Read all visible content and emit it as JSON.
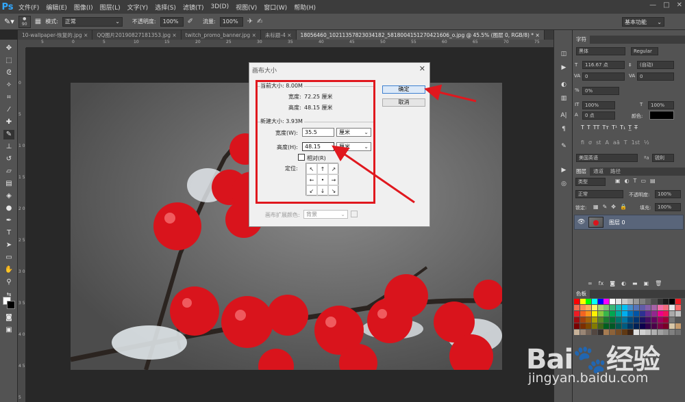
{
  "app": {
    "logo": "Ps",
    "menu": [
      "文件(F)",
      "编辑(E)",
      "图像(I)",
      "图层(L)",
      "文字(Y)",
      "选择(S)",
      "滤镜(T)",
      "3D(D)",
      "视图(V)",
      "窗口(W)",
      "帮助(H)"
    ],
    "window_controls": [
      "—",
      "□",
      "✕"
    ]
  },
  "options": {
    "brush_size": "90",
    "mode_label": "模式:",
    "mode_value": "正常",
    "opacity_label": "不透明度:",
    "opacity_value": "100%",
    "flow_label": "流量:",
    "flow_value": "100%",
    "workspace": "基本功能"
  },
  "tabs": [
    {
      "label": "10-wallpaper-恢复的.jpg",
      "active": false
    },
    {
      "label": "QQ图片20190827181353.jpg",
      "active": false
    },
    {
      "label": "twitch_promo_banner.jpg",
      "active": false
    },
    {
      "label": "未标题-4",
      "active": false
    },
    {
      "label": "18056460_10211357823034182_5818004151270421606_o.jpg @ 45.5% (图层 0, RGB/8) *",
      "active": true
    }
  ],
  "ruler_top": [
    "5",
    "0",
    "5",
    "10",
    "15",
    "20",
    "25",
    "30",
    "35",
    "40",
    "45",
    "50",
    "55",
    "60",
    "65",
    "70",
    "75"
  ],
  "ruler_left": [
    "0",
    "5",
    "1 0",
    "1 5",
    "2 0",
    "2 5",
    "3 0",
    "3 5",
    "4 0",
    "4 5",
    "5"
  ],
  "panels": {
    "char_tab": "字符",
    "font_family": "黑体",
    "font_style": "Regular",
    "font_size": "116.67 点",
    "leading": "(自动)",
    "kerning": "0",
    "tracking": "0",
    "scale": "0%",
    "vscale": "100%",
    "hscale": "100%",
    "baseline": "0 点",
    "color_label": "颜色:",
    "language": "美国英语",
    "antialias": "锐利",
    "layer_tabs": [
      "图层",
      "通道",
      "路径"
    ],
    "filter_label": "类型",
    "blend_mode": "正常",
    "layer_opacity_label": "不透明度:",
    "layer_opacity": "100%",
    "lock_label": "锁定:",
    "fill_label": "填充:",
    "fill_value": "100%",
    "layer_name": "图层 0",
    "swatches_tab": "色板",
    "swatch_colors": [
      "#ff0000",
      "#ffff00",
      "#00ff00",
      "#00ffff",
      "#0000ff",
      "#ff00ff",
      "#ffffff",
      "#e6e6e6",
      "#cccccc",
      "#b3b3b3",
      "#999999",
      "#808080",
      "#666666",
      "#4d4d4d",
      "#333333",
      "#1a1a1a",
      "#000000",
      "#ed1c24",
      "#f26c4f",
      "#f68e56",
      "#fbaf5c",
      "#fff467",
      "#acd372",
      "#7cc576",
      "#3bb878",
      "#1abbb4",
      "#00bff3",
      "#438ccb",
      "#5574b9",
      "#605ca8",
      "#855fa8",
      "#a763a8",
      "#f06ea9",
      "#f26d7d",
      "#e6e6e6",
      "#ff6a6a",
      "#ed1c24",
      "#f26522",
      "#f7941d",
      "#fff200",
      "#8dc73f",
      "#39b54a",
      "#00a651",
      "#00a99d",
      "#00aeef",
      "#0072bc",
      "#0054a6",
      "#2e3192",
      "#662d91",
      "#92278f",
      "#ec008c",
      "#ed145b",
      "#aaaaaa",
      "#c0c0c0",
      "#9e0b0f",
      "#a0410d",
      "#a36209",
      "#aba000",
      "#598527",
      "#1a7b30",
      "#007236",
      "#00746b",
      "#0076a3",
      "#004b80",
      "#003471",
      "#1b1464",
      "#440e62",
      "#630460",
      "#9e005d",
      "#9e0039",
      "#777777",
      "#555555",
      "#790000",
      "#7b2e00",
      "#7d4900",
      "#827b00",
      "#406618",
      "#005e20",
      "#005826",
      "#005952",
      "#005b7f",
      "#003663",
      "#002157",
      "#0d004c",
      "#32004b",
      "#4b0049",
      "#7b0046",
      "#7a0026",
      "#d8c7a8",
      "#c69c6d",
      "#c7b299",
      "#998675",
      "#736357",
      "#534741",
      "#362f2d",
      "#a67c52",
      "#8c6239",
      "#754c24",
      "#603913",
      "#3c2415",
      "#e0e0e0",
      "#d0d0d0",
      "#c0c0c0",
      "#b0b0b0",
      "#a0a0a0",
      "#909090",
      "#808080",
      "#707070"
    ]
  },
  "dialog": {
    "title": "画布大小",
    "current_size_label": "当前大小: 8.00M",
    "current_width_label": "宽度:",
    "current_width_value": "72.25 厘米",
    "current_height_label": "高度:",
    "current_height_value": "48.15 厘米",
    "new_size_label": "新建大小: 3.93M",
    "width_label": "宽度(W):",
    "width_value": "35.5",
    "width_unit": "厘米",
    "height_label": "高度(H):",
    "height_value": "48.15",
    "height_unit": "厘米",
    "relative_label": "相对(R)",
    "anchor_label": "定位:",
    "anchor_arrows": [
      "↖",
      "↑",
      "↗",
      "←",
      "•",
      "→",
      "↙",
      "↓",
      "↘"
    ],
    "ext_color_label": "画布扩展颜色:",
    "ext_color_value": "背景",
    "ok_label": "确定",
    "cancel_label": "取消"
  },
  "watermark": {
    "text": "Bai🐾经验",
    "url": "jingyan.baidu.com"
  },
  "colors": {
    "annotation_red": "#e0181e",
    "berry_red": "#d9141c",
    "dialog_bg": "#f0f0f0",
    "panel_bg": "#535353"
  }
}
